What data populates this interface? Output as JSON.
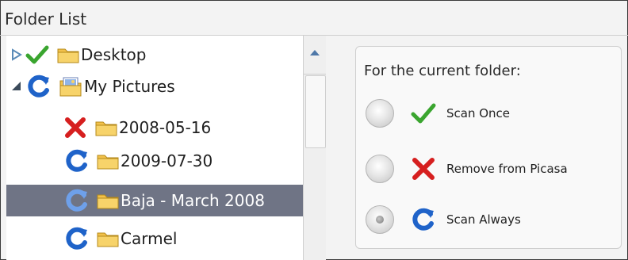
{
  "window": {
    "title": "Folder List"
  },
  "tree": {
    "items": [
      {
        "label": "Desktop",
        "status": "check-icon",
        "expander": "expand-right"
      },
      {
        "label": "My Pictures",
        "status": "refresh-icon",
        "expander": "collapse-down"
      },
      {
        "label": "2008-05-16",
        "status": "x-icon"
      },
      {
        "label": "2009-07-30",
        "status": "refresh-icon"
      },
      {
        "label": "Baja - March 2008",
        "status": "refresh-icon",
        "selected": true
      },
      {
        "label": "Carmel",
        "status": "refresh-icon"
      }
    ]
  },
  "panel": {
    "title": "For the current folder:",
    "options": [
      {
        "label": "Scan Once",
        "icon": "check-icon",
        "selected": false
      },
      {
        "label": "Remove from Picasa",
        "icon": "x-icon",
        "selected": false
      },
      {
        "label": "Scan Always",
        "icon": "refresh-icon",
        "selected": true
      }
    ]
  },
  "colors": {
    "selection": "#6f7485",
    "check": "#3aa52f",
    "x": "#d61f1f",
    "refresh": "#1f63c9",
    "folder": "#f2c14b"
  }
}
